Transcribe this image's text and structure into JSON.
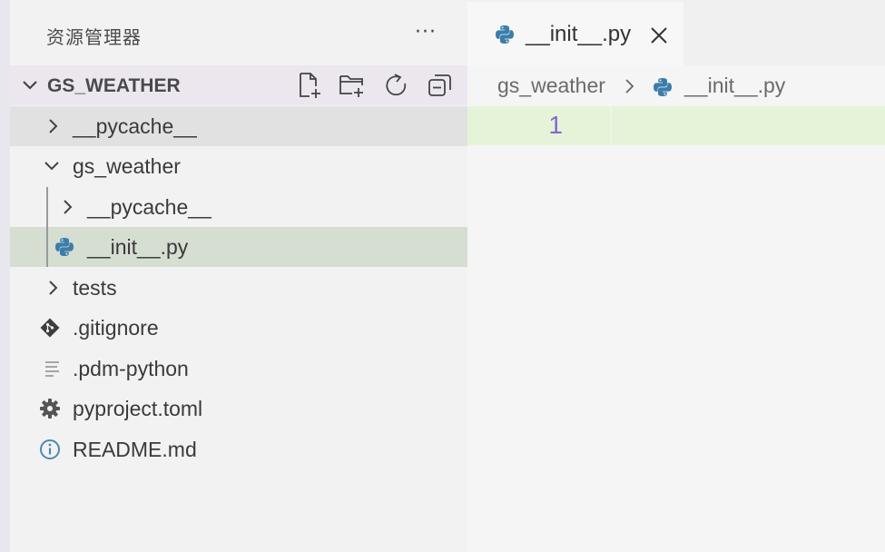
{
  "explorer": {
    "title": "资源管理器",
    "more_label": "···",
    "section": {
      "title": "GS_WEATHER",
      "actions": [
        "new-file-icon",
        "new-folder-icon",
        "refresh-icon",
        "collapse-all-icon"
      ]
    },
    "tree": [
      {
        "label": "__pycache__",
        "type": "folder",
        "state": "collapsed"
      },
      {
        "label": "gs_weather",
        "type": "folder",
        "state": "expanded"
      },
      {
        "label": "__pycache__",
        "type": "folder",
        "state": "collapsed"
      },
      {
        "label": "__init__.py",
        "type": "python-file",
        "selected": true
      },
      {
        "label": "tests",
        "type": "folder",
        "state": "collapsed"
      },
      {
        "label": ".gitignore",
        "type": "git-file"
      },
      {
        "label": ".pdm-python",
        "type": "text-file"
      },
      {
        "label": "pyproject.toml",
        "type": "settings-file"
      },
      {
        "label": "README.md",
        "type": "info-file"
      }
    ]
  },
  "editor": {
    "tab": {
      "label": "__init__.py",
      "icon": "python-icon",
      "close_icon": "close-icon"
    },
    "breadcrumb": [
      "gs_weather",
      "__init__.py"
    ],
    "lines": [
      "1"
    ]
  },
  "colors": {
    "python_blue": "#3b7dab",
    "line_number": "#8866cc",
    "current_line": "#e5f4d8",
    "selected_row": "#d6ddd1"
  }
}
